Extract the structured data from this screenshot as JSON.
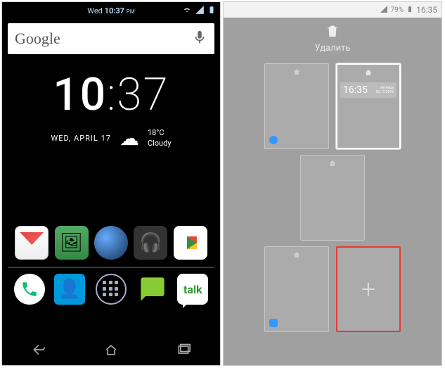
{
  "left": {
    "status": {
      "date": "Wed",
      "time": "10:37",
      "pm": "PM"
    },
    "search": {
      "brand": "Google"
    },
    "clock": {
      "hours": "10",
      "minutes": "37",
      "date": "WED, APRIL 17",
      "temp": "18°C",
      "condition": "Cloudy"
    },
    "apps": [
      {
        "name": "gmail"
      },
      {
        "name": "gallery"
      },
      {
        "name": "browser"
      },
      {
        "name": "music"
      },
      {
        "name": "play-store"
      }
    ],
    "dock": [
      {
        "name": "phone"
      },
      {
        "name": "contacts"
      },
      {
        "name": "app-drawer"
      },
      {
        "name": "messaging"
      },
      {
        "name": "talk",
        "label": "talk"
      }
    ]
  },
  "right": {
    "status": {
      "battery": "79%",
      "time": "16:35"
    },
    "delete_label": "Удалить",
    "screens": {
      "selected_clock": {
        "time": "16:35",
        "dayinfo": "пятница",
        "dateinfo": "02.12.2016"
      },
      "add_glyph": "+"
    }
  }
}
